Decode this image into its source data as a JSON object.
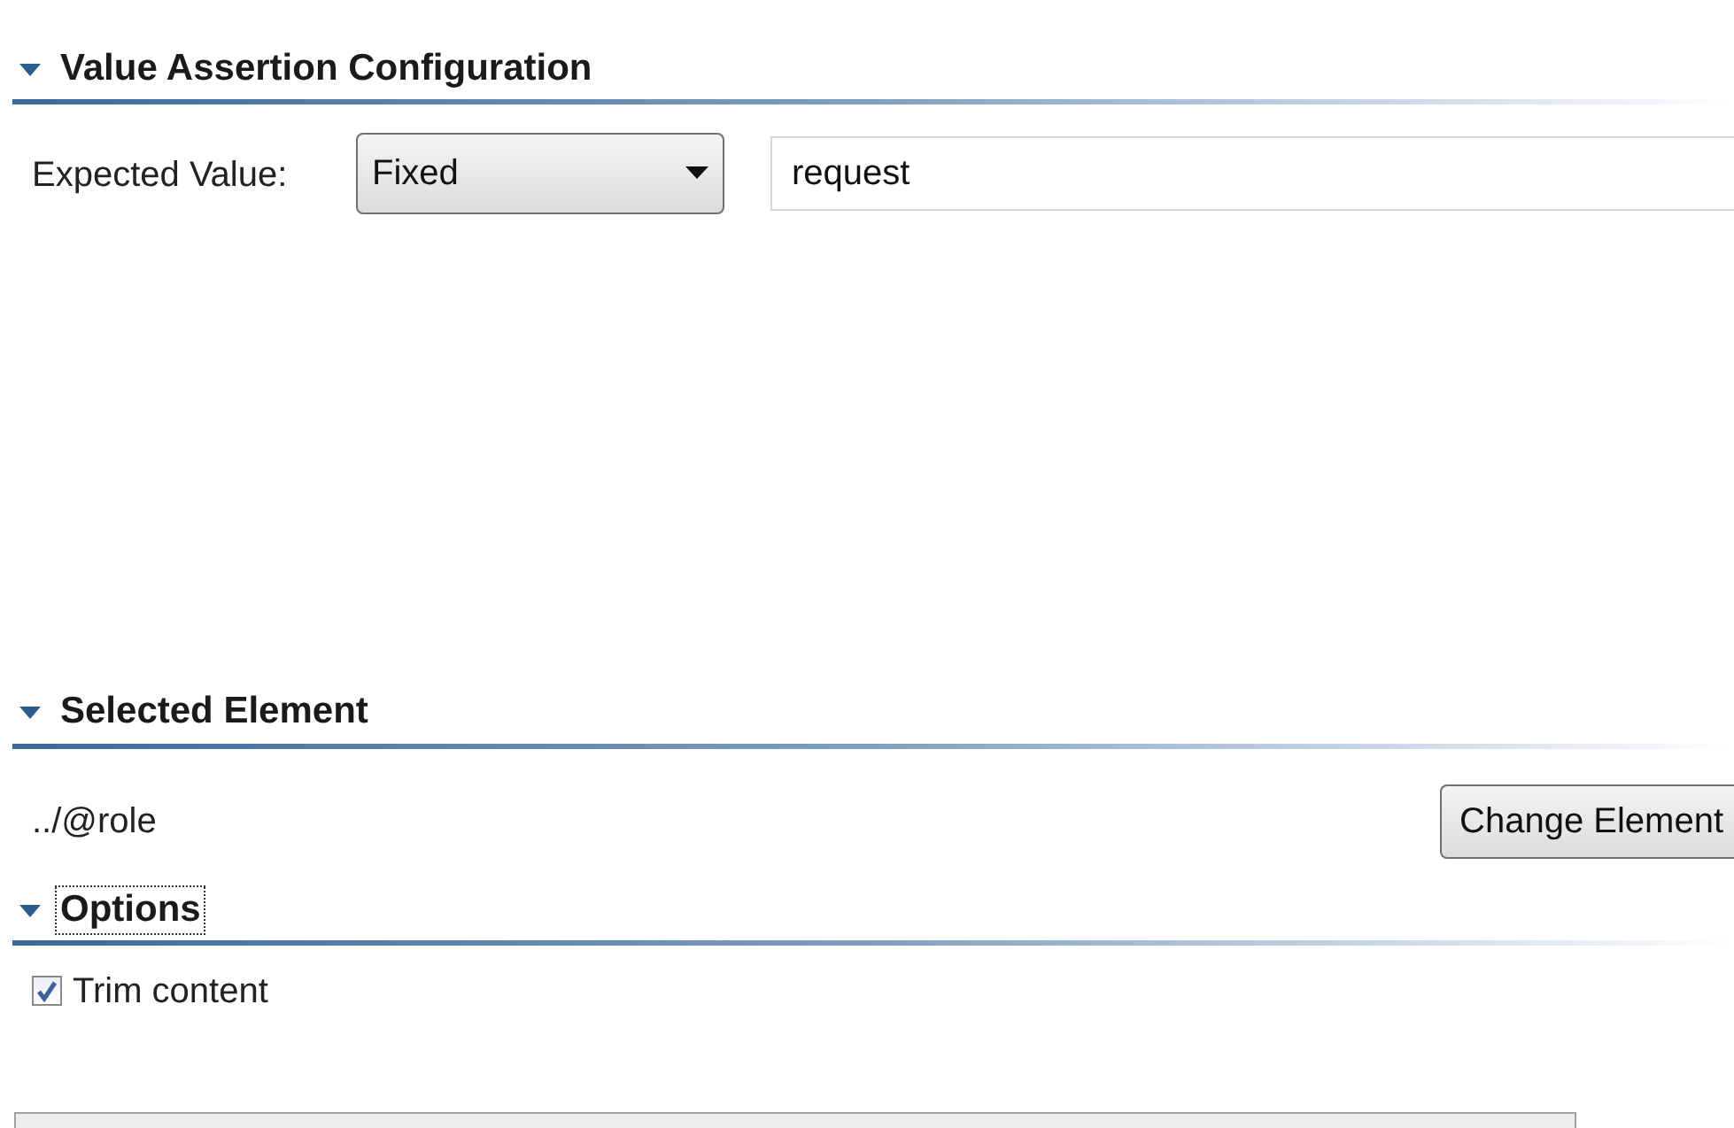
{
  "sections": [
    {
      "title": "Value Assertion Configuration",
      "expanded": true,
      "focused": false,
      "kind": "expected_value",
      "label": "Expected Value:",
      "dropdown": {
        "value": "Fixed"
      },
      "input": {
        "value": "request"
      }
    },
    {
      "title": "Selected Element",
      "expanded": true,
      "focused": false,
      "kind": "selected_element",
      "path": "../@role",
      "button": "Change Element"
    },
    {
      "title": "Options",
      "expanded": true,
      "focused": true,
      "kind": "options",
      "checkboxes": [
        {
          "label": "Trim content",
          "checked": true
        }
      ]
    }
  ]
}
